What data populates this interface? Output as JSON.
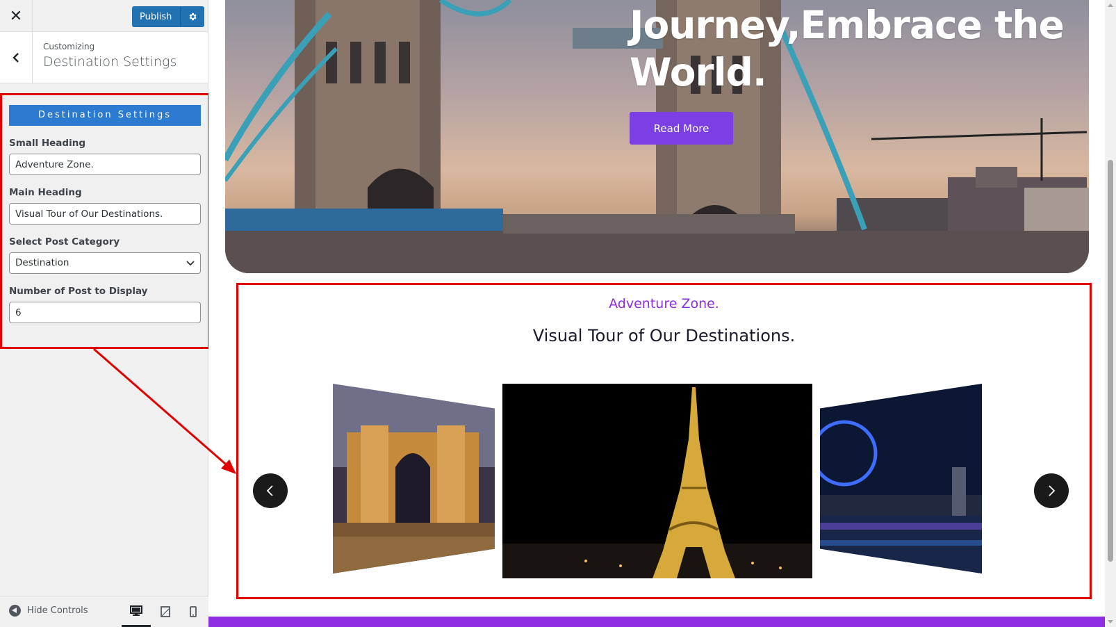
{
  "customizer": {
    "close_icon": "close-icon",
    "publish_label": "Publish",
    "settings_icon": "gear-icon",
    "back_icon": "chevron-left-icon",
    "breadcrumb": "Customizing",
    "section_title": "Destination Settings",
    "panel": {
      "heading": "Destination Settings",
      "small_heading_label": "Small Heading",
      "small_heading_value": "Adventure Zone.",
      "main_heading_label": "Main Heading",
      "main_heading_value": "Visual Tour of Our Destinations.",
      "category_label": "Select Post Category",
      "category_value": "Destination",
      "count_label": "Number of Post to Display",
      "count_value": "6"
    },
    "footer": {
      "hide_controls_label": "Hide Controls",
      "devices": [
        "desktop-icon",
        "tablet-icon",
        "mobile-icon"
      ],
      "active_device": "desktop"
    }
  },
  "preview": {
    "hero": {
      "heading": "Journey,Embrace the\nWorld.",
      "button_label": "Read More"
    },
    "destinations": {
      "small_heading": "Adventure Zone.",
      "main_heading": "Visual Tour of Our Destinations.",
      "prev_icon": "chevron-left-icon",
      "next_icon": "chevron-right-icon"
    }
  },
  "colors": {
    "accent_purple": "#7b3fe4",
    "small_heading_purple": "#8e2de2",
    "wp_blue": "#2271b1",
    "panel_heading_blue": "#2c7bd0",
    "highlight_red": "#e00000"
  }
}
